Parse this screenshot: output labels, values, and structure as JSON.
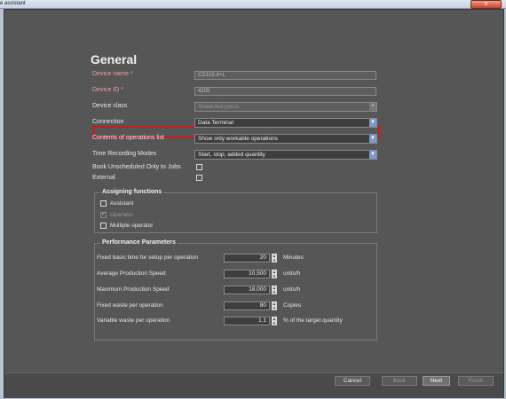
{
  "window": {
    "title": "e assistant",
    "close_label": "x"
  },
  "page": {
    "heading": "General"
  },
  "fields": {
    "device_name": {
      "label": "Device name *",
      "value": "CD102-8+L"
    },
    "device_id": {
      "label": "Device ID *",
      "value": "4205"
    },
    "device_class": {
      "label": "Device class",
      "value": "Sheet-fed press"
    },
    "connection": {
      "label": "Connection",
      "value": "Data Terminal"
    },
    "operations_list": {
      "label": "Contents of operations list",
      "value": "Show only workable operations"
    },
    "time_recording": {
      "label": "Time Recording Modes",
      "value": "Start, stop, added quantity"
    },
    "book_unscheduled": {
      "label": "Book Unscheduled Only to Jobs",
      "checked": false
    },
    "external": {
      "label": "External",
      "checked": false
    }
  },
  "assigning": {
    "title": "Assigning functions",
    "items": [
      {
        "label": "Assistant",
        "checked": false,
        "disabled": false
      },
      {
        "label": "Operator",
        "checked": true,
        "disabled": true
      },
      {
        "label": "Multiple operator",
        "checked": false,
        "disabled": false
      }
    ]
  },
  "performance": {
    "title": "Performance Parameters",
    "rows": [
      {
        "label": "Fixed basic time for setup per operation",
        "value": "20",
        "unit": "Minutes"
      },
      {
        "label": "Average Production Speed",
        "value": "10,500",
        "unit": "units/h"
      },
      {
        "label": "Maximum Production Speed",
        "value": "18,000",
        "unit": "units/h"
      },
      {
        "label": "Fixed waste per operation",
        "value": "80",
        "unit": "Copies"
      },
      {
        "label": "Variable waste per operation",
        "value": "1.1",
        "unit": "% of the target quantity"
      }
    ]
  },
  "buttons": {
    "cancel": "Cancel",
    "back": "Back",
    "next": "Next",
    "finish": "Finish"
  },
  "icons": {
    "dropdown": "chevron-down-icon",
    "spin_up": "arrow-up-icon",
    "spin_down": "arrow-down-icon"
  }
}
